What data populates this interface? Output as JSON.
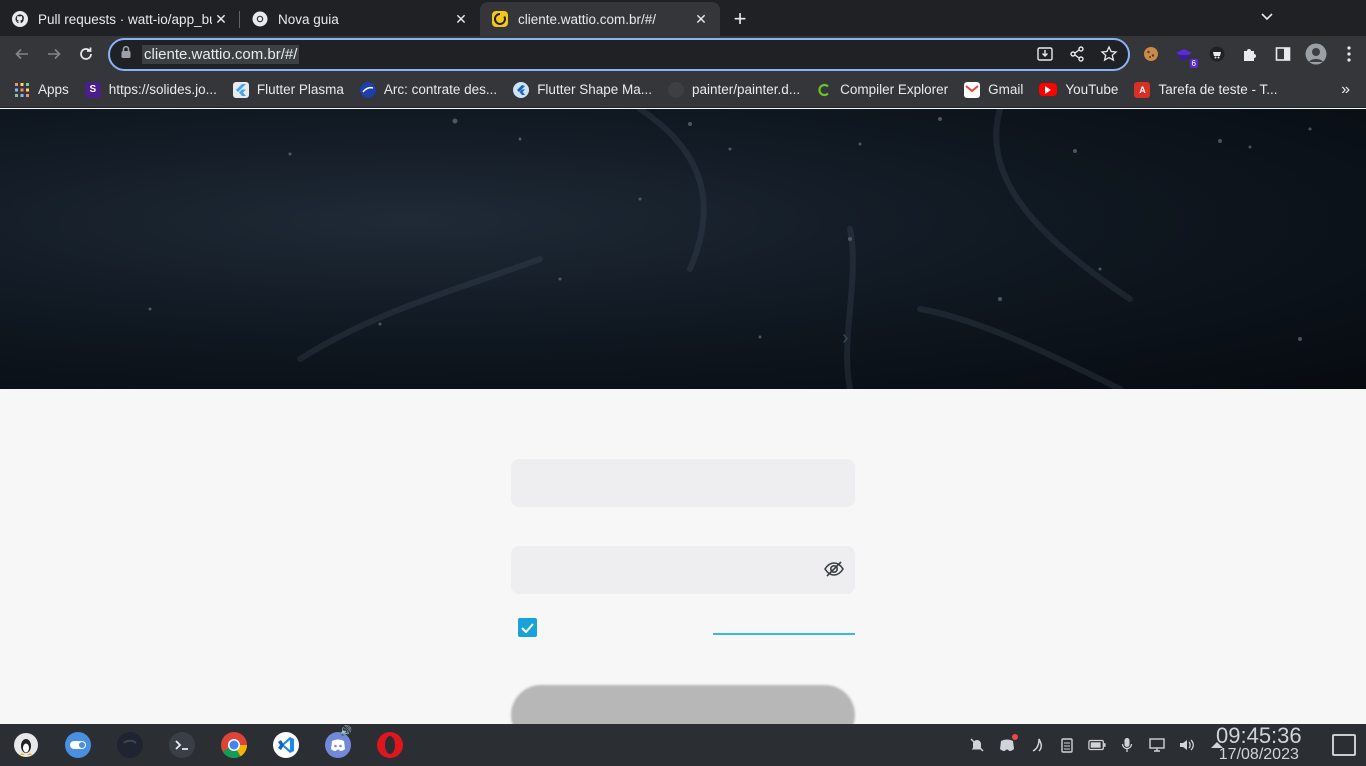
{
  "tabs": [
    {
      "title": "Pull requests · watt-io/app_bu",
      "icon": "github-icon"
    },
    {
      "title": "Nova guia",
      "icon": "chrome-icon"
    },
    {
      "title": "cliente.wattio.com.br/#/",
      "icon": "wattio-icon",
      "active": true
    }
  ],
  "omnibox": {
    "url": "cliente.wattio.com.br/#/"
  },
  "extensions": {
    "badge": "6"
  },
  "bookmarks": [
    {
      "label": "Apps",
      "icon": "apps-grid-icon"
    },
    {
      "label": "https://solides.jo...",
      "icon": "solides-icon"
    },
    {
      "label": "Flutter Plasma",
      "icon": "flutter-icon"
    },
    {
      "label": "Arc: contrate des...",
      "icon": "arc-icon"
    },
    {
      "label": "Flutter Shape Ma...",
      "icon": "flutter-shape-icon"
    },
    {
      "label": "painter/painter.d...",
      "icon": "github-icon"
    },
    {
      "label": "Compiler Explorer",
      "icon": "compiler-explorer-icon"
    },
    {
      "label": "Gmail",
      "icon": "gmail-icon"
    },
    {
      "label": "YouTube",
      "icon": "youtube-icon"
    },
    {
      "label": "Tarefa de teste - T...",
      "icon": "tarefa-icon"
    }
  ],
  "login": {
    "email_value": "",
    "password_value": "",
    "remember_checked": true
  },
  "taskbar": {
    "apps": [
      "linux-menu-icon",
      "toggle-icon",
      "moon-icon",
      "terminal-icon",
      "chrome-icon",
      "vscode-icon",
      "discord-icon",
      "opera-icon"
    ],
    "time": "09:45:36",
    "date": "17/08/2023"
  },
  "colors": {
    "accent": "#1aa3da",
    "omnibox_focus": "#8ab4f8",
    "link_underline": "#3cb6e6"
  }
}
